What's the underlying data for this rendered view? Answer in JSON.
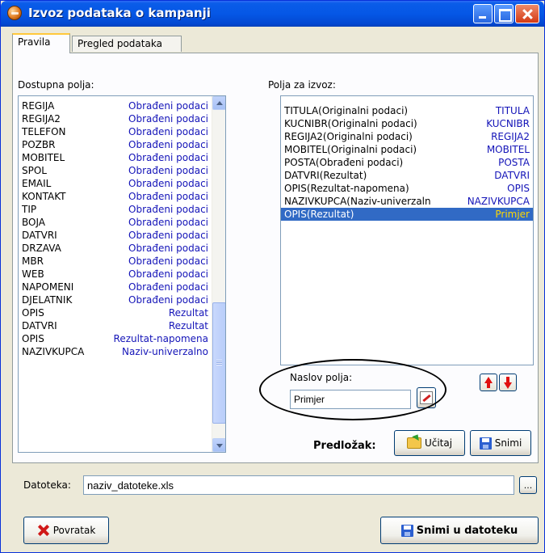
{
  "window": {
    "title": "Izvoz podataka o kampanji"
  },
  "tabs": [
    {
      "label": "Pravila",
      "active": true
    },
    {
      "label": "Pregled podataka",
      "active": false
    }
  ],
  "available_fields": {
    "label": "Dostupna polja:",
    "items": [
      {
        "name": "REGIJA",
        "source": "Obrađeni podaci"
      },
      {
        "name": "REGIJA2",
        "source": "Obrađeni podaci"
      },
      {
        "name": "TELEFON",
        "source": "Obrađeni podaci"
      },
      {
        "name": "POZBR",
        "source": "Obrađeni podaci"
      },
      {
        "name": "MOBITEL",
        "source": "Obrađeni podaci"
      },
      {
        "name": "SPOL",
        "source": "Obrađeni podaci"
      },
      {
        "name": "EMAIL",
        "source": "Obrađeni podaci"
      },
      {
        "name": "KONTAKT",
        "source": "Obrađeni podaci"
      },
      {
        "name": "TIP",
        "source": "Obrađeni podaci"
      },
      {
        "name": "BOJA",
        "source": "Obrađeni podaci"
      },
      {
        "name": "DATVRI",
        "source": "Obrađeni podaci"
      },
      {
        "name": "DRZAVA",
        "source": "Obrađeni podaci"
      },
      {
        "name": "MBR",
        "source": "Obrađeni podaci"
      },
      {
        "name": "WEB",
        "source": "Obrađeni podaci"
      },
      {
        "name": "NAPOMENI",
        "source": "Obrađeni podaci"
      },
      {
        "name": "DJELATNIK",
        "source": "Obrađeni podaci"
      },
      {
        "name": "OPIS",
        "source": "Rezultat"
      },
      {
        "name": "DATVRI",
        "source": "Rezultat"
      },
      {
        "name": "OPIS",
        "source": "Rezultat-napomena"
      },
      {
        "name": "NAZIVKUPCA",
        "source": "Naziv-univerzalno"
      }
    ]
  },
  "export_fields": {
    "label": "Polja za izvoz:",
    "items": [
      {
        "name": "TITULA(Originalni podaci)",
        "header": "TITULA",
        "selected": false
      },
      {
        "name": "KUCNIBR(Originalni podaci)",
        "header": "KUCNIBR",
        "selected": false
      },
      {
        "name": "REGIJA2(Originalni podaci)",
        "header": "REGIJA2",
        "selected": false
      },
      {
        "name": "MOBITEL(Originalni podaci)",
        "header": "MOBITEL",
        "selected": false
      },
      {
        "name": "POSTA(Obrađeni podaci)",
        "header": "POSTA",
        "selected": false
      },
      {
        "name": "DATVRI(Rezultat)",
        "header": "DATVRI",
        "selected": false
      },
      {
        "name": "OPIS(Rezultat-napomena)",
        "header": "OPIS",
        "selected": false
      },
      {
        "name": "NAZIVKUPCA(Naziv-univerzaln",
        "header": "NAZIVKUPCA",
        "selected": false
      },
      {
        "name": "OPIS(Rezultat)",
        "header": "Primjer",
        "selected": true
      }
    ]
  },
  "field_header": {
    "label": "Naslov polja:",
    "value": "Primjer"
  },
  "template": {
    "label": "Predložak:",
    "load_label": "Učitaj",
    "save_label": "Snimi"
  },
  "file": {
    "label": "Datoteka:",
    "value": "naziv_datoteke.xls",
    "browse_label": "..."
  },
  "footer": {
    "back_label": "Povratak",
    "save_to_file_label": "Snimi u datoteku"
  }
}
